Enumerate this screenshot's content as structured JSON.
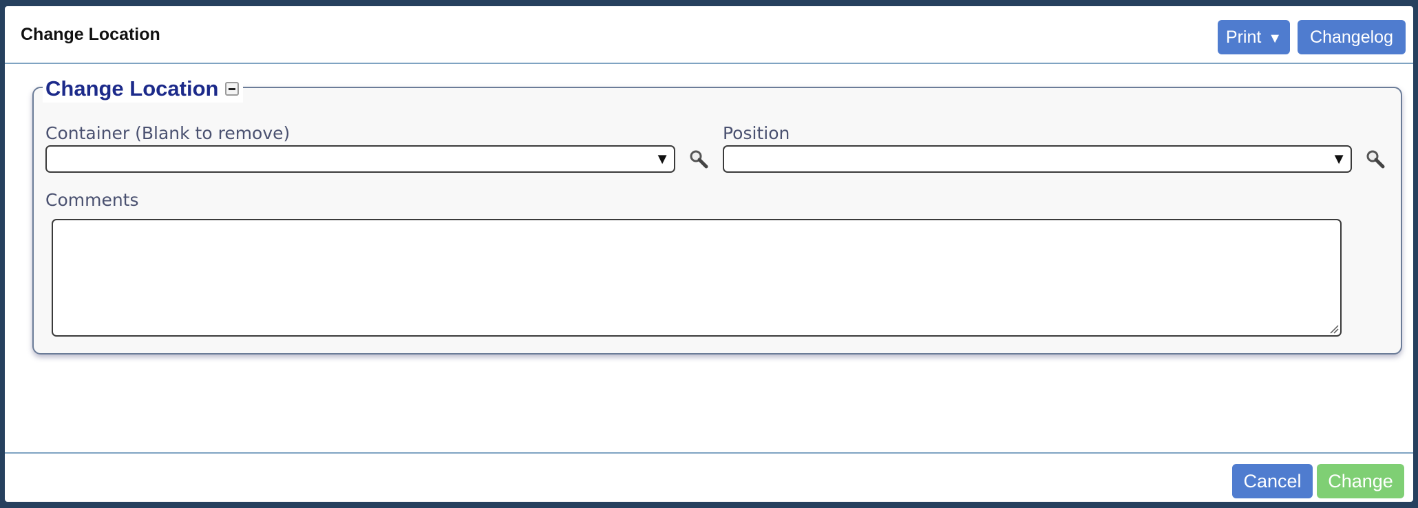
{
  "dialog": {
    "title": "Change Location",
    "toolbar": {
      "print_label": "Print",
      "print_caret": "▼",
      "changelog_label": "Changelog"
    }
  },
  "section": {
    "legend": "Change Location",
    "collapse_icon": "minus-box-icon"
  },
  "form": {
    "container": {
      "label": "Container (Blank to remove)",
      "value": "",
      "arrow": "▼",
      "lookup_icon": "search-icon"
    },
    "position": {
      "label": "Position",
      "value": "",
      "arrow": "▼",
      "lookup_icon": "search-icon"
    },
    "comments": {
      "label": "Comments",
      "value": ""
    }
  },
  "footer": {
    "cancel_label": "Cancel",
    "change_label": "Change"
  },
  "colors": {
    "primary_button": "#4f7ccf",
    "confirm_button": "#7fcf74",
    "legend_text": "#1c2a8a",
    "divider": "#7fa3c2"
  }
}
